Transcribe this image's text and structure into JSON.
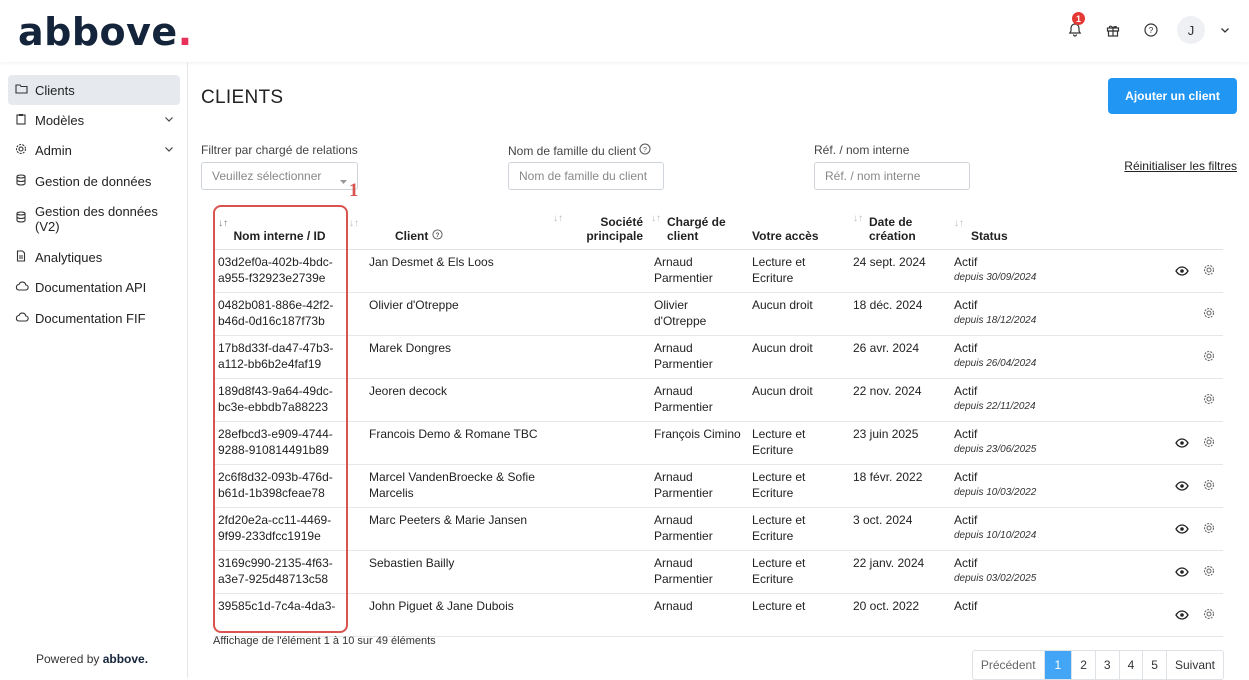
{
  "brand": {
    "name": "abbove",
    "dot": "."
  },
  "header": {
    "notification_count": "1",
    "avatar_letter": "J"
  },
  "sidebar": {
    "items": [
      {
        "label": "Clients",
        "icon": "folder-icon"
      },
      {
        "label": "Modèles",
        "icon": "clipboard-icon"
      },
      {
        "label": "Admin",
        "icon": "gear-icon"
      },
      {
        "label": "Gestion de données",
        "icon": "database-icon"
      },
      {
        "label": "Gestion des données (V2)",
        "icon": "database-icon"
      },
      {
        "label": "Analytiques",
        "icon": "document-icon"
      },
      {
        "label": "Documentation API",
        "icon": "cloud-icon"
      },
      {
        "label": "Documentation FIF",
        "icon": "cloud-icon"
      }
    ],
    "powered_prefix": "Powered by",
    "powered_brand": "abbove."
  },
  "page": {
    "title": "CLIENTS",
    "add_button": "Ajouter un client"
  },
  "filters": {
    "relation_label": "Filtrer par chargé de relations",
    "relation_placeholder": "Veuillez sélectionner",
    "family_label": "Nom de famille du client",
    "family_placeholder": "Nom de famille du client",
    "ref_label": "Réf. / nom interne",
    "ref_placeholder": "Réf. / nom interne",
    "reset": "Réinitialiser les filtres"
  },
  "table": {
    "headers": {
      "internal": "Nom interne / ID",
      "client": "Client",
      "company_1": "Société",
      "company_2": "principale",
      "manager_1": "Chargé de",
      "manager_2": "client",
      "access": "Votre accès",
      "created_1": "Date de",
      "created_2": "création",
      "status": "Status"
    },
    "rows": [
      {
        "id1": "03d2ef0a-402b-4bdc-",
        "id2": "a955-f32923e2739e",
        "client": "Jan Desmet & Els Loos",
        "company": "",
        "manager1": "Arnaud",
        "manager2": "Parmentier",
        "access1": "Lecture et",
        "access2": "Ecriture",
        "created": "24 sept. 2024",
        "status": "Actif",
        "since": "depuis 30/09/2024",
        "eye": true
      },
      {
        "id1": "0482b081-886e-42f2-",
        "id2": "b46d-0d16c187f73b",
        "client": "Olivier d'Otreppe",
        "company": "",
        "manager1": "Olivier",
        "manager2": "d'Otreppe",
        "access1": "Aucun droit",
        "access2": "",
        "created": "18 déc. 2024",
        "status": "Actif",
        "since": "depuis 18/12/2024",
        "eye": false
      },
      {
        "id1": "17b8d33f-da47-47b3-",
        "id2": "a112-bb6b2e4faf19",
        "client": "Marek Dongres",
        "company": "",
        "manager1": "Arnaud",
        "manager2": "Parmentier",
        "access1": "Aucun droit",
        "access2": "",
        "created": "26 avr. 2024",
        "status": "Actif",
        "since": "depuis 26/04/2024",
        "eye": false
      },
      {
        "id1": "189d8f43-9a64-49dc-",
        "id2": "bc3e-ebbdb7a88223",
        "client": "Jeoren decock",
        "company": "",
        "manager1": "Arnaud",
        "manager2": "Parmentier",
        "access1": "Aucun droit",
        "access2": "",
        "created": "22 nov. 2024",
        "status": "Actif",
        "since": "depuis 22/11/2024",
        "eye": false
      },
      {
        "id1": "28efbcd3-e909-4744-",
        "id2": "9288-910814491b89",
        "client": "Francois Demo & Romane TBC",
        "company": "",
        "manager1": "François Cimino",
        "manager2": "",
        "access1": "Lecture et",
        "access2": "Ecriture",
        "created": "23 juin 2025",
        "status": "Actif",
        "since": "depuis 23/06/2025",
        "eye": true
      },
      {
        "id1": "2c6f8d32-093b-476d-",
        "id2": "b61d-1b398cfeae78",
        "client": "Marcel VandenBroecke & Sofie",
        "client2": "Marcelis",
        "company": "",
        "manager1": "Arnaud",
        "manager2": "Parmentier",
        "access1": "Lecture et",
        "access2": "Ecriture",
        "created": "18 févr. 2022",
        "status": "Actif",
        "since": "depuis 10/03/2022",
        "eye": true
      },
      {
        "id1": "2fd20e2a-cc11-4469-",
        "id2": "9f99-233dfcc1919e",
        "client": "Marc Peeters & Marie Jansen",
        "company": "",
        "manager1": "Arnaud",
        "manager2": "Parmentier",
        "access1": "Lecture et",
        "access2": "Ecriture",
        "created": "3 oct. 2024",
        "status": "Actif",
        "since": "depuis 10/10/2024",
        "eye": true
      },
      {
        "id1": "3169c990-2135-4f63-",
        "id2": "a3e7-925d48713c58",
        "client": "Sebastien Bailly",
        "company": "",
        "manager1": "Arnaud",
        "manager2": "Parmentier",
        "access1": "Lecture et",
        "access2": "Ecriture",
        "created": "22 janv. 2024",
        "status": "Actif",
        "since": "depuis 03/02/2025",
        "eye": true
      },
      {
        "id1": "39585c1d-7c4a-4da3-",
        "id2": "",
        "client": "John Piguet & Jane Dubois",
        "company": "",
        "manager1": "Arnaud",
        "manager2": "",
        "access1": "Lecture et",
        "access2": "",
        "created": "20 oct. 2022",
        "status": "Actif",
        "since": "",
        "eye": true
      }
    ]
  },
  "footer": {
    "info": "Affichage de l'élément 1 à 10 sur 49 éléments"
  },
  "pagination": {
    "prev": "Précédent",
    "pages": [
      "1",
      "2",
      "3",
      "4",
      "5"
    ],
    "next": "Suivant"
  },
  "annotation": {
    "number": "1"
  },
  "colors": {
    "brand_dark": "#14243a",
    "brand_dot": "#e8315a",
    "primary": "#2196f3",
    "annotation": "#d9534f"
  }
}
